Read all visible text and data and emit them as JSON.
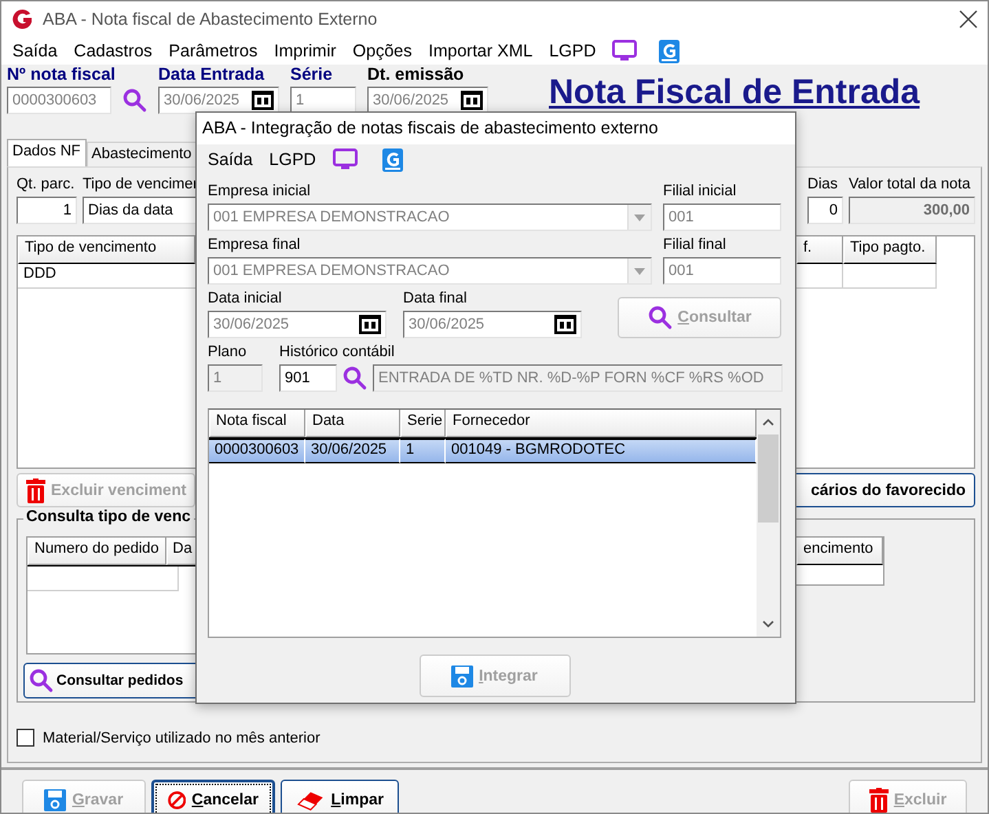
{
  "window": {
    "title": "ABA - Nota fiscal de Abastecimento Externo"
  },
  "menu": [
    "Saída",
    "Cadastros",
    "Parâmetros",
    "Imprimir",
    "Opções",
    "Importar XML",
    "LGPD"
  ],
  "header": {
    "fields": [
      {
        "label": "Nº nota fiscal",
        "value": "0000300603",
        "kind": "search"
      },
      {
        "label": "Data Entrada",
        "value": "30/06/2025",
        "kind": "date"
      },
      {
        "label": "Série",
        "value": "1",
        "kind": "text"
      },
      {
        "label": "Dt. emissão",
        "value": "30/06/2025",
        "kind": "date"
      }
    ],
    "title": "Nota Fiscal de Entrada"
  },
  "tabs": [
    {
      "label": "Dados NF",
      "selected": true
    },
    {
      "label": "Abastecimento",
      "selected": false
    }
  ],
  "panel": {
    "qt_parc": {
      "label": "Qt. parc.",
      "value": "1"
    },
    "tipo_vencimento": {
      "label": "Tipo de vencimer",
      "value": "Dias da data"
    },
    "dias": {
      "label": "Dias",
      "value": "0"
    },
    "valor_total": {
      "label": "Valor total da nota",
      "value": "300,00"
    },
    "vencimentos": {
      "left_column": "Tipo de vencimento",
      "left_rows": [
        "DDD"
      ],
      "right_columns": [
        "f.",
        "Tipo pagto."
      ]
    },
    "excluir_button": {
      "label": "Excluir venciment",
      "disabled": true
    },
    "bancarios_button": {
      "label": "cários do favorecido"
    },
    "consulta": {
      "title": "Consulta tipo de venc",
      "left_columns": [
        "Numero do pedido",
        "Da"
      ],
      "right_columns": [
        "encimento"
      ],
      "button": "Consultar pedidos"
    },
    "checkbox": {
      "label": "Material/Serviço utilizado no mês anterior",
      "checked": false
    }
  },
  "footer_buttons": [
    {
      "label": "Gravar",
      "kind": "save",
      "disabled": true,
      "focused": false
    },
    {
      "label": "Cancelar",
      "kind": "cancel",
      "disabled": false,
      "focused": true
    },
    {
      "label": "Limpar",
      "kind": "eraser",
      "disabled": false,
      "focused": false
    },
    {
      "label": "Excluir",
      "kind": "trash",
      "disabled": true,
      "focused": false
    }
  ],
  "dialog": {
    "title": "ABA - Integração de notas fiscais de abastecimento externo",
    "menu": [
      "Saída",
      "LGPD"
    ],
    "empresa_inicial": {
      "label": "Empresa inicial",
      "value": "001 EMPRESA DEMONSTRACAO",
      "disabled": true
    },
    "filial_inicial": {
      "label": "Filial inicial",
      "value": "001",
      "disabled": true
    },
    "empresa_final": {
      "label": "Empresa final",
      "value": "001 EMPRESA DEMONSTRACAO",
      "disabled": true
    },
    "filial_final": {
      "label": "Filial final",
      "value": "001",
      "disabled": true
    },
    "data_inicial": {
      "label": "Data inicial",
      "value": "30/06/2025",
      "disabled": true
    },
    "data_final": {
      "label": "Data final",
      "value": "30/06/2025",
      "disabled": true
    },
    "consultar_button": {
      "label": "Consultar",
      "disabled": true
    },
    "plano": {
      "label": "Plano",
      "value": "1",
      "disabled": true
    },
    "historico": {
      "label": "Histórico contábil",
      "code": "901",
      "description": "ENTRADA DE %TD NR. %D-%P FORN %CF %RS %OD"
    },
    "table": {
      "columns": [
        "Nota fiscal",
        "Data",
        "Serie",
        "Fornecedor"
      ],
      "rows": [
        {
          "cells": [
            "0000300603",
            "30/06/2025",
            "1",
            "001049 - BGMRODOTEC"
          ],
          "selected": true
        }
      ]
    },
    "integrar_button": {
      "label": "Integrar",
      "disabled": true
    }
  }
}
